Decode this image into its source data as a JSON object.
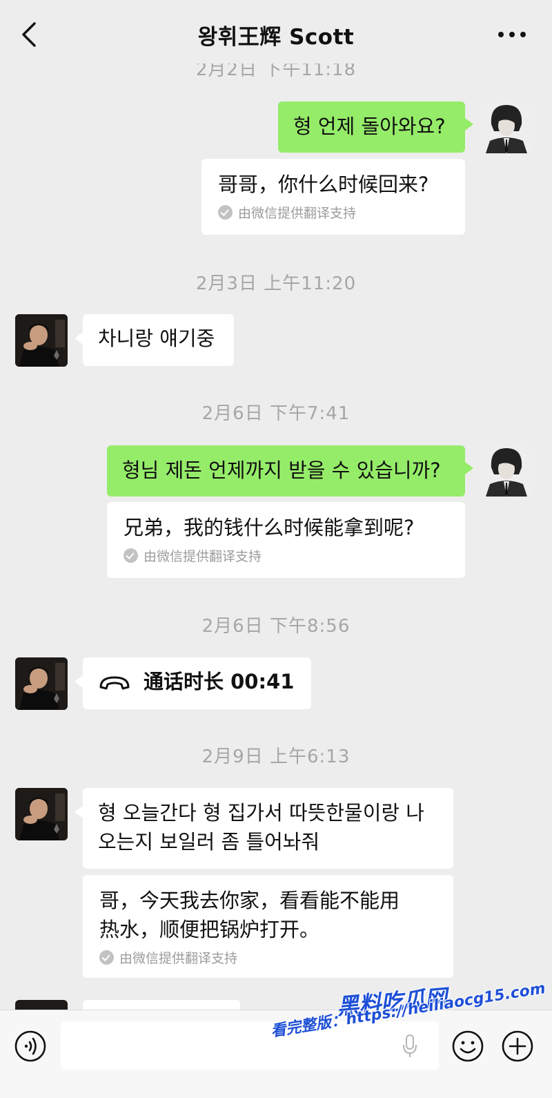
{
  "header": {
    "title": "왕휘王辉 Scott",
    "back_icon": "chevron-left-icon",
    "more_icon": "more-dots-icon"
  },
  "messages": {
    "ts0": "2月2日 下午11:18",
    "m1": {
      "text": "형 언제 돌아와요?",
      "translation": "哥哥，你什么时候回来?",
      "translated_by": "由微信提供翻译支持"
    },
    "ts1": "2月3日 上午11:20",
    "m2": {
      "text": "차니랑 얘기중"
    },
    "ts2": "2月6日 下午7:41",
    "m3": {
      "text": "형님 제돈 언제까지 받을 수 있습니까?",
      "translation": "兄弟，我的钱什么时候能拿到呢?",
      "translated_by": "由微信提供翻译支持"
    },
    "ts3": "2月6日 下午8:56",
    "m4": {
      "text": "通话时长 00:41",
      "icon": "phone-hangup-icon"
    },
    "ts4": "2月9日 上午6:13",
    "m5": {
      "line1": "형 오늘간다 형 집가서 따뜻한물이랑 나",
      "line2": "오는지 보일러 좀 틀어놔줘",
      "translation_line1": "哥，今天我去你家，看看能不能用",
      "translation_line2": "热水，顺便把锅炉打开。",
      "translated_by": "由微信提供翻译支持"
    }
  },
  "input_bar": {
    "voice_icon": "voice-icon",
    "mic_icon": "mic-icon",
    "emoji_icon": "emoji-icon",
    "plus_icon": "plus-icon"
  },
  "watermark": {
    "line1": "黑料吃瓜网",
    "line2": "看完整版：https://heiliaocg15.com"
  },
  "colors": {
    "background": "#ededed",
    "sent_bubble": "#95ec69",
    "received_bubble": "#ffffff",
    "timestamp": "#a6a6a6",
    "watermark": "#1e4fd6"
  }
}
